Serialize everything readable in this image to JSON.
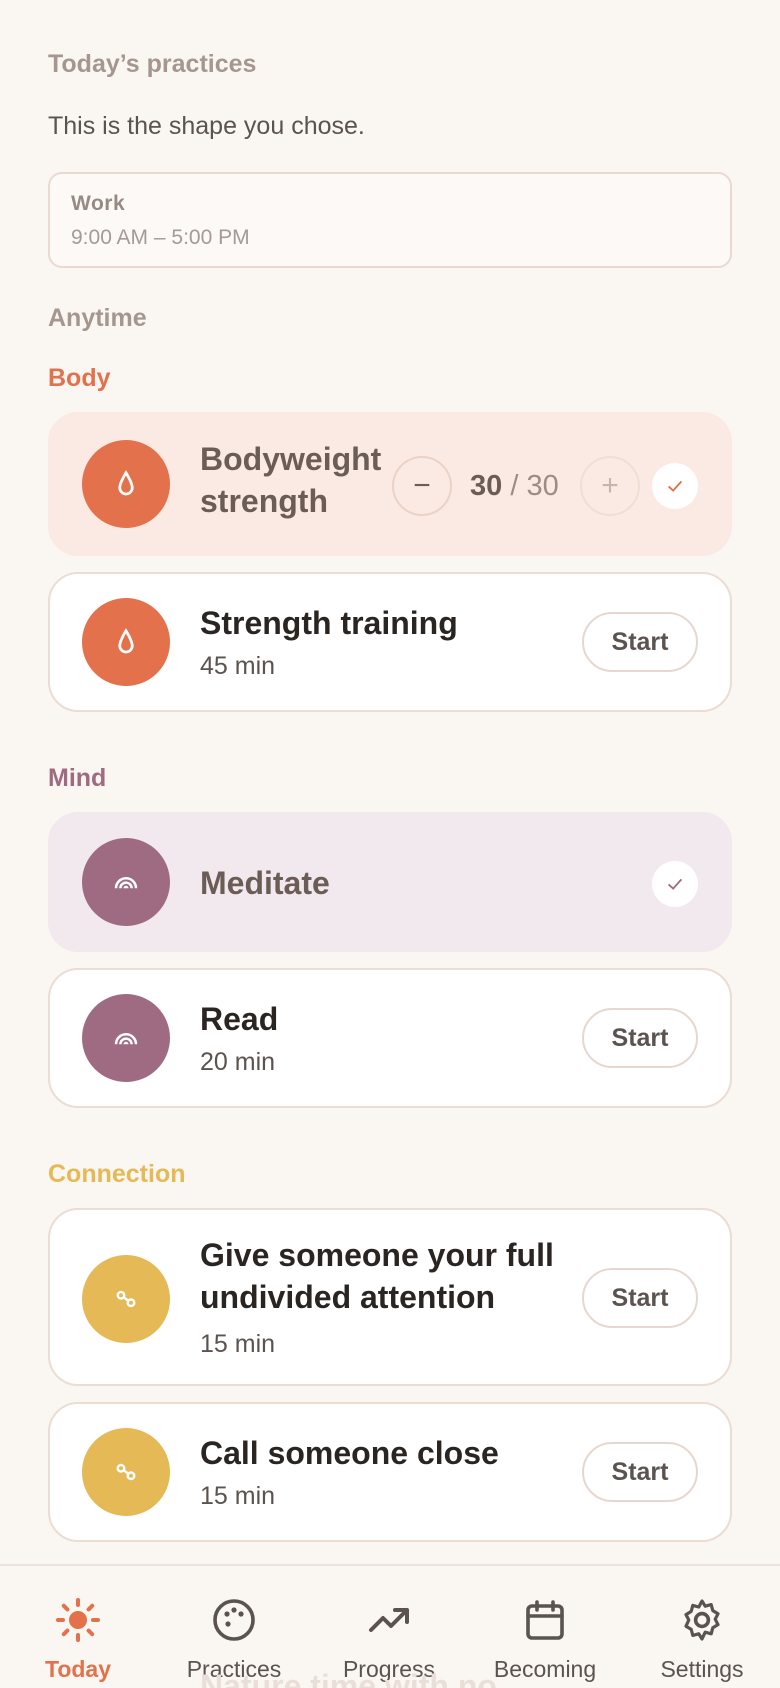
{
  "header": {
    "title": "Today’s practices",
    "subtitle": "This is the shape you chose."
  },
  "work": {
    "label": "Work",
    "time": "9:00 AM – 5:00 PM"
  },
  "anytime_label": "Anytime",
  "groups": {
    "body": {
      "label": "Body",
      "color": "#e2714c"
    },
    "mind": {
      "label": "Mind",
      "color": "#9e6b83"
    },
    "connection": {
      "label": "Connection",
      "color": "#e5b955"
    }
  },
  "practices": {
    "bodyweight": {
      "title_line1": "Bodyweight",
      "title_line2": "strength",
      "count": "30",
      "total": "/ 30",
      "minus": "−",
      "plus": "+"
    },
    "strength": {
      "title": "Strength training",
      "duration": "45 min",
      "action": "Start"
    },
    "meditate": {
      "title": "Meditate"
    },
    "read": {
      "title": "Read",
      "duration": "20 min",
      "action": "Start"
    },
    "attention": {
      "title_line1": "Give someone your full",
      "title_line2": "undivided attention",
      "duration": "15 min",
      "action": "Start"
    },
    "call": {
      "title": "Call someone close",
      "duration": "15 min",
      "action": "Start"
    }
  },
  "ghost": "Nature time with no",
  "tabs": [
    {
      "label": "Today",
      "icon": "sun-icon"
    },
    {
      "label": "Practices",
      "icon": "palette-icon"
    },
    {
      "label": "Progress",
      "icon": "trend-up-icon"
    },
    {
      "label": "Becoming",
      "icon": "calendar-icon"
    },
    {
      "label": "Settings",
      "icon": "gear-icon"
    }
  ]
}
